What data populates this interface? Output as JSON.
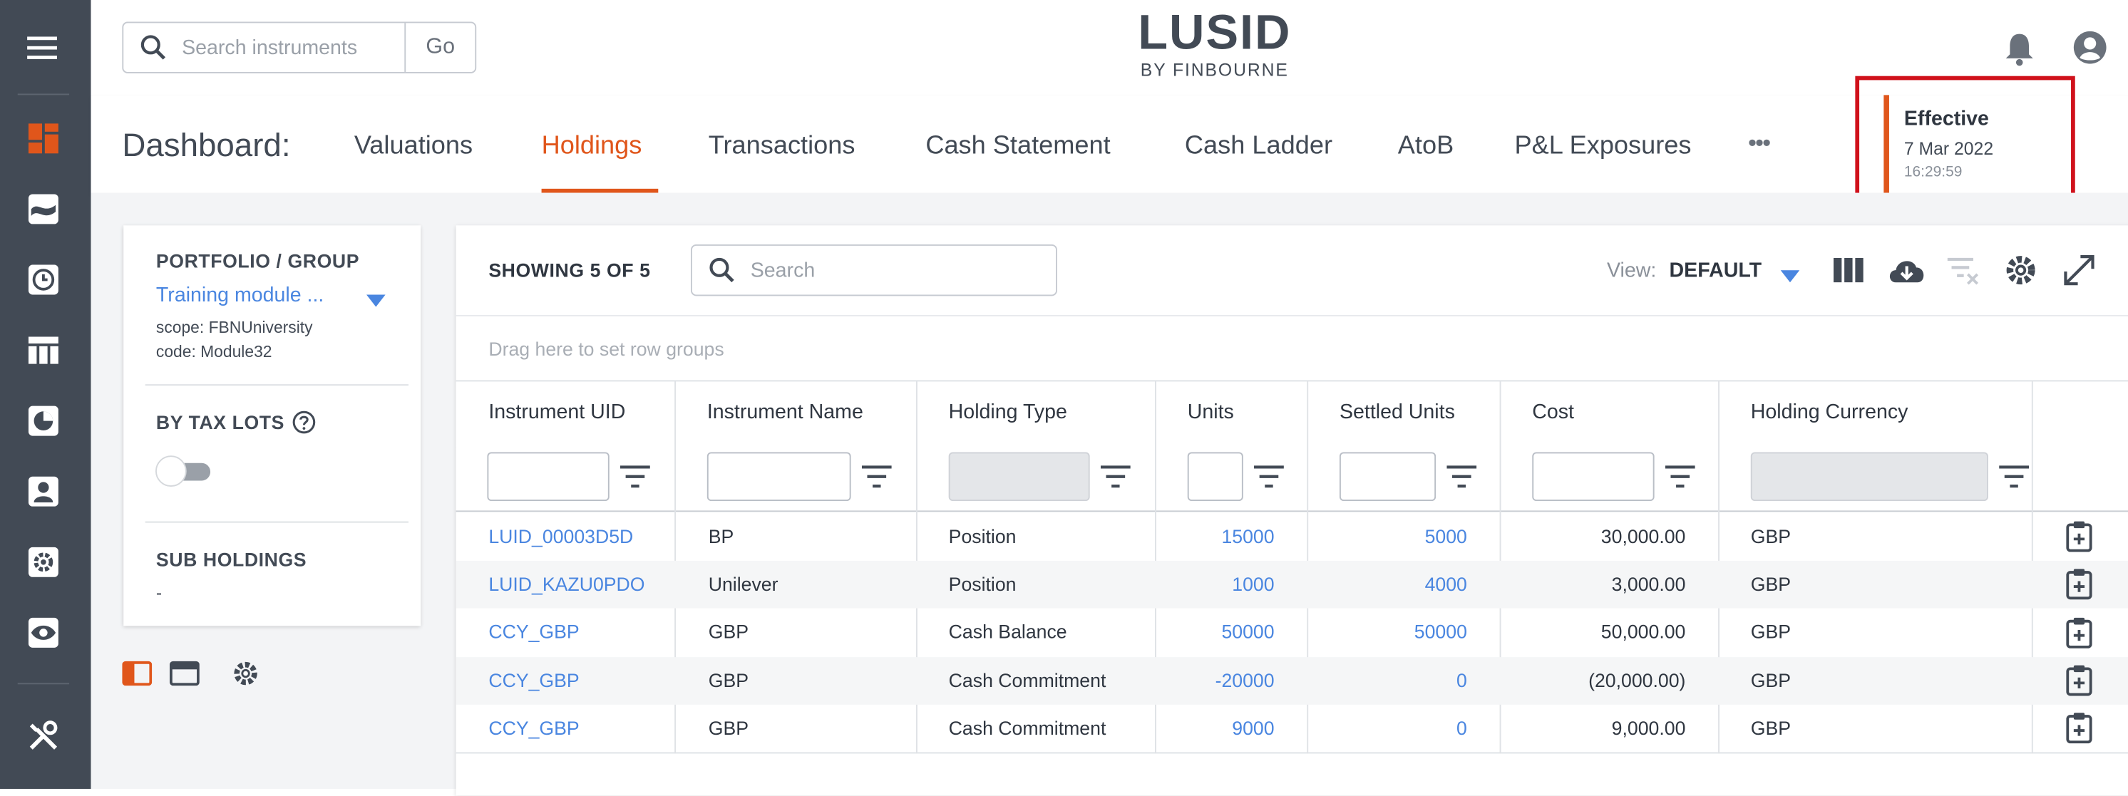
{
  "search": {
    "placeholder": "Search instruments",
    "go_label": "Go"
  },
  "logo": {
    "title": "LUSID",
    "subtitle": "BY FINBOURNE"
  },
  "nav": {
    "dashboard_label": "Dashboard:",
    "tabs": [
      "Valuations",
      "Holdings",
      "Transactions",
      "Cash Statement",
      "Cash Ladder",
      "AtoB",
      "P&L Exposures"
    ],
    "active_tab": "Holdings",
    "more_label": "•••"
  },
  "effective": {
    "label": "Effective",
    "date": "7 Mar 2022",
    "time": "16:29:59"
  },
  "left_panel": {
    "portfolio_heading": "PORTFOLIO / GROUP",
    "portfolio_name": "Training module ...",
    "scope": "scope: FBNUniversity",
    "code": "code: Module32",
    "tax_lots_heading": "BY TAX LOTS",
    "tax_lots_enabled": false,
    "sub_holdings_heading": "SUB HOLDINGS",
    "sub_holdings_value": "-"
  },
  "grid": {
    "showing": "SHOWING 5 OF 5",
    "search_placeholder": "Search",
    "view_label": "View:",
    "view_value": "DEFAULT",
    "drag_hint": "Drag here to set row groups",
    "columns": [
      "Instrument UID",
      "Instrument Name",
      "Holding Type",
      "Units",
      "Settled Units",
      "Cost",
      "Holding Currency"
    ],
    "rows": [
      {
        "uid": "LUID_00003D5D",
        "name": "BP",
        "type": "Position",
        "units": "15000",
        "settled": "5000",
        "cost": "30,000.00",
        "currency": "GBP"
      },
      {
        "uid": "LUID_KAZU0PDO",
        "name": "Unilever",
        "type": "Position",
        "units": "1000",
        "settled": "4000",
        "cost": "3,000.00",
        "currency": "GBP"
      },
      {
        "uid": "CCY_GBP",
        "name": "GBP",
        "type": "Cash Balance",
        "units": "50000",
        "settled": "50000",
        "cost": "50,000.00",
        "currency": "GBP"
      },
      {
        "uid": "CCY_GBP",
        "name": "GBP",
        "type": "Cash Commitment",
        "units": "-20000",
        "settled": "0",
        "cost": "(20,000.00)",
        "currency": "GBP"
      },
      {
        "uid": "CCY_GBP",
        "name": "GBP",
        "type": "Cash Commitment",
        "units": "9000",
        "settled": "0",
        "cost": "9,000.00",
        "currency": "GBP"
      }
    ]
  },
  "colors": {
    "accent": "#e0561b",
    "link": "#4a86e0",
    "rail": "#424a55",
    "highlight": "#d0111b"
  },
  "icons": {
    "rail": [
      "menu-icon",
      "dashboard-icon",
      "chart-area-icon",
      "clock-icon",
      "table-icon",
      "pie-chart-icon",
      "person-card-icon",
      "gear-icon",
      "eye-icon",
      "tools-icon"
    ],
    "top": [
      "bell-icon",
      "account-icon"
    ],
    "toolbar": [
      "columns-icon",
      "download-icon",
      "clear-filter-icon",
      "gear-icon",
      "expand-icon"
    ],
    "layout": [
      "panel-left-icon",
      "panel-top-icon",
      "gear-icon"
    ]
  }
}
